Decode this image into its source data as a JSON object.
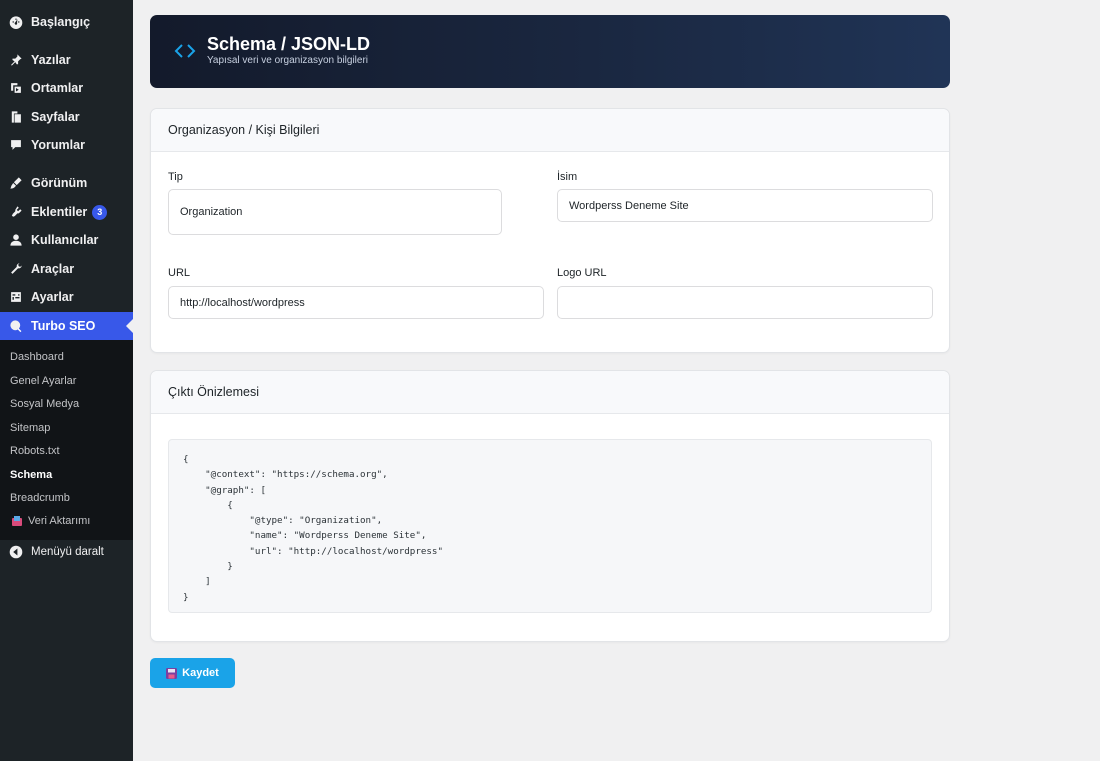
{
  "sidebar": {
    "items": [
      {
        "label": "Başlangıç",
        "icon": "dashboard-icon"
      },
      {
        "label": "Yazılar",
        "icon": "pin-icon"
      },
      {
        "label": "Ortamlar",
        "icon": "media-icon"
      },
      {
        "label": "Sayfalar",
        "icon": "pages-icon"
      },
      {
        "label": "Yorumlar",
        "icon": "comments-icon"
      },
      {
        "label": "Görünüm",
        "icon": "appearance-icon"
      },
      {
        "label": "Eklentiler",
        "icon": "plugins-icon",
        "badge": "3"
      },
      {
        "label": "Kullanıcılar",
        "icon": "users-icon"
      },
      {
        "label": "Araçlar",
        "icon": "tools-icon"
      },
      {
        "label": "Ayarlar",
        "icon": "settings-icon"
      },
      {
        "label": "Turbo SEO",
        "icon": "search-icon"
      }
    ],
    "submenu": [
      {
        "label": "Dashboard"
      },
      {
        "label": "Genel Ayarlar"
      },
      {
        "label": "Sosyal Medya"
      },
      {
        "label": "Sitemap"
      },
      {
        "label": "Robots.txt"
      },
      {
        "label": "Schema"
      },
      {
        "label": "Breadcrumb"
      },
      {
        "label": "Veri Aktarımı"
      }
    ],
    "collapse_label": "Menüyü daralt"
  },
  "header": {
    "title": "Schema / JSON-LD",
    "subtitle": "Yapısal veri ve organizasyon bilgileri"
  },
  "org_card": {
    "title": "Organizasyon / Kişi Bilgileri",
    "type_label": "Tip",
    "type_value": "Organization",
    "name_label": "İsim",
    "name_value": "Wordperss Deneme Site",
    "url_label": "URL",
    "url_value": "http://localhost/wordpress",
    "logo_label": "Logo URL",
    "logo_value": ""
  },
  "preview_card": {
    "title": "Çıktı Önizlemesi",
    "code": "{\n    \"@context\": \"https://schema.org\",\n    \"@graph\": [\n        {\n            \"@type\": \"Organization\",\n            \"name\": \"Wordperss Deneme Site\",\n            \"url\": \"http://localhost/wordpress\"\n        }\n    ]\n}"
  },
  "save_button": {
    "label": "Kaydet"
  },
  "colors": {
    "sidebar_bg": "#1d2327",
    "active_menu": "#3858e9",
    "save_button": "#1aa3e8",
    "banner_dark": "#131a2b"
  }
}
